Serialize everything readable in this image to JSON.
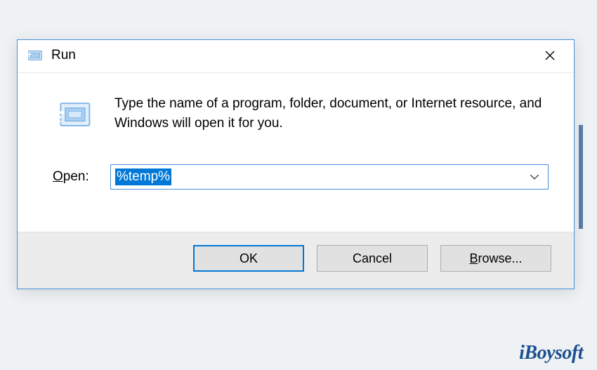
{
  "dialog": {
    "title": "Run",
    "description": "Type the name of a program, folder, document, or Internet resource, and Windows will open it for you.",
    "open_label_prefix": "O",
    "open_label_rest": "pen:",
    "input_value": "%temp%",
    "buttons": {
      "ok": "OK",
      "cancel": "Cancel",
      "browse_prefix": "B",
      "browse_rest": "rowse..."
    }
  },
  "watermark": "iBoysoft"
}
